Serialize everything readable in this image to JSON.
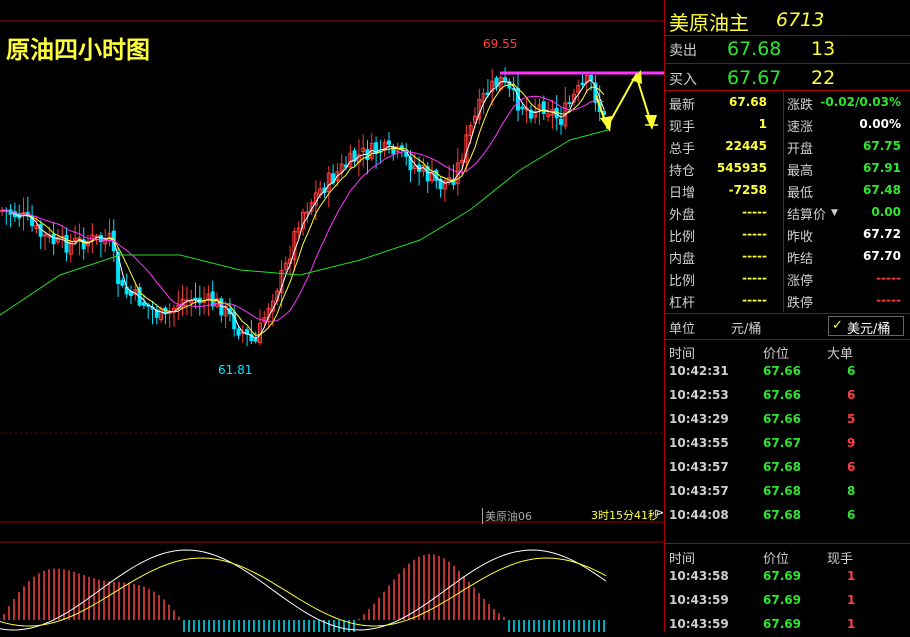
{
  "chart": {
    "title": "原油四小时图",
    "high_label": "69.55",
    "low_label": "61.81",
    "contract_label": "美原油06",
    "countdown": "3时15分41秒",
    "countdown_arrow": ">",
    "colors": {
      "up": "#ff3c3c",
      "down": "#00e5ff",
      "ma5": "#ffffff",
      "ma10": "#ffff33",
      "ma20": "#ff33ff",
      "ma60": "#22dd22",
      "resistance": "#ff33ff",
      "arrow": "#ffff33",
      "grid": "#800000"
    }
  },
  "quote": {
    "name": "美原油主",
    "code": "6713",
    "sell_label": "卖出",
    "sell_price": "67.68",
    "sell_volume": "13",
    "buy_label": "买入",
    "buy_price": "67.67",
    "buy_volume": "22"
  },
  "stats": {
    "left": [
      {
        "label": "最新",
        "value": "67.68",
        "color": "yellow"
      },
      {
        "label": "现手",
        "value": "1",
        "color": "yellow"
      },
      {
        "label": "总手",
        "value": "22445",
        "color": "yellow"
      },
      {
        "label": "持仓",
        "value": "545935",
        "color": "yellow"
      },
      {
        "label": "日增",
        "value": "-7258",
        "color": "yellow"
      },
      {
        "label": "外盘",
        "value": "-----",
        "color": "yellow"
      },
      {
        "label": "比例",
        "value": "-----",
        "color": "yellow"
      },
      {
        "label": "内盘",
        "value": "-----",
        "color": "yellow"
      },
      {
        "label": "比例",
        "value": "-----",
        "color": "yellow"
      },
      {
        "label": "杠杆",
        "value": "-----",
        "color": "yellow"
      }
    ],
    "right": [
      {
        "label": "涨跌",
        "value": "-0.02/0.03%",
        "color": "green"
      },
      {
        "label": "速涨",
        "value": "0.00%",
        "color": "white"
      },
      {
        "label": "开盘",
        "value": "67.75",
        "color": "green"
      },
      {
        "label": "最高",
        "value": "67.91",
        "color": "green"
      },
      {
        "label": "最低",
        "value": "67.48",
        "color": "green"
      },
      {
        "label": "结算价",
        "value": "0.00",
        "color": "green"
      },
      {
        "label": "昨收",
        "value": "67.72",
        "color": "white"
      },
      {
        "label": "昨结",
        "value": "67.70",
        "color": "white"
      },
      {
        "label": "涨停",
        "value": "-----",
        "color": "red"
      },
      {
        "label": "跌停",
        "value": "-----",
        "color": "red"
      }
    ]
  },
  "unit": {
    "label": "单位",
    "option1": "元/桶",
    "option2": "美元/桶",
    "check": "✓"
  },
  "trades1": {
    "headers": [
      "时间",
      "价位",
      "大单"
    ],
    "rows": [
      {
        "time": "10:42:31",
        "price": "67.66",
        "vol": "6",
        "vcolor": "green"
      },
      {
        "time": "10:42:53",
        "price": "67.66",
        "vol": "6",
        "vcolor": "red"
      },
      {
        "time": "10:43:29",
        "price": "67.66",
        "vol": "5",
        "vcolor": "red"
      },
      {
        "time": "10:43:55",
        "price": "67.67",
        "vol": "9",
        "vcolor": "red"
      },
      {
        "time": "10:43:57",
        "price": "67.68",
        "vol": "6",
        "vcolor": "red"
      },
      {
        "time": "10:43:57",
        "price": "67.68",
        "vol": "8",
        "vcolor": "green"
      },
      {
        "time": "10:44:08",
        "price": "67.68",
        "vol": "6",
        "vcolor": "green"
      }
    ]
  },
  "trades2": {
    "headers": [
      "时间",
      "价位",
      "现手"
    ],
    "rows": [
      {
        "time": "10:43:58",
        "price": "67.69",
        "vol": "1",
        "vcolor": "red"
      },
      {
        "time": "10:43:59",
        "price": "67.69",
        "vol": "1",
        "vcolor": "red"
      },
      {
        "time": "10:43:59",
        "price": "67.69",
        "vol": "1",
        "vcolor": "red"
      }
    ]
  }
}
